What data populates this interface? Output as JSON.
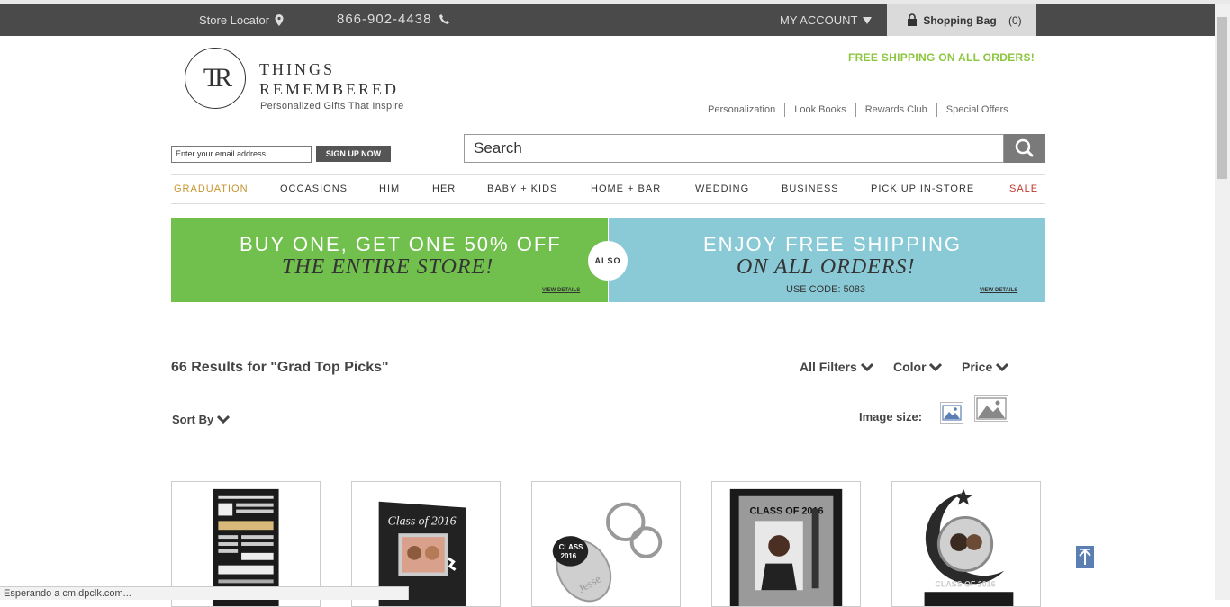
{
  "header": {
    "store_locator": "Store Locator",
    "phone": "866-902-4438",
    "my_account": "MY ACCOUNT",
    "bag_label": "Shopping Bag",
    "bag_count": "(0)"
  },
  "brand": {
    "monogram": "TR",
    "name_line1": "THINGS",
    "name_line2": "REMEMBERED",
    "tagline": "Personalized Gifts That Inspire"
  },
  "free_shipping": "FREE SHIPPING ON ALL ORDERS!",
  "utility_links": [
    "Personalization",
    "Look Books",
    "Rewards Club",
    "Special Offers"
  ],
  "newsletter": {
    "placeholder": "Enter your email address",
    "button": "SIGN UP NOW"
  },
  "search": {
    "placeholder": "Search"
  },
  "nav": [
    {
      "label": "GRADUATION",
      "color": "#c7962f"
    },
    {
      "label": "OCCASIONS"
    },
    {
      "label": "HIM"
    },
    {
      "label": "HER"
    },
    {
      "label": "BABY + KIDS"
    },
    {
      "label": "HOME + BAR"
    },
    {
      "label": "WEDDING"
    },
    {
      "label": "BUSINESS"
    },
    {
      "label": "PICK UP IN-STORE"
    },
    {
      "label": "SALE",
      "color": "#c0392b"
    }
  ],
  "promo": {
    "left_line1": "BUY ONE, GET ONE 50% OFF",
    "left_line2": "THE ENTIRE STORE!",
    "also": "ALSO",
    "right_line1": "ENJOY FREE SHIPPING",
    "right_line2": "ON ALL ORDERS!",
    "code": "USE CODE: 5083",
    "view_details": "VIEW DETAILS",
    "left_color": "#71c04d",
    "right_color": "#8acad6"
  },
  "results": {
    "title": "66 Results for \"Grad Top Picks\"",
    "filters": [
      "All Filters",
      "Color",
      "Price"
    ],
    "sort_by": "Sort By",
    "image_size": "Image size:"
  },
  "products": [
    {
      "name": "Grad inspiration print"
    },
    {
      "name": "Class of 2016 photo album"
    },
    {
      "name": "Class of 2016 keychain"
    },
    {
      "name": "Class of 2016 photo frame"
    },
    {
      "name": "Class of 2016 spinning ornament"
    }
  ],
  "status_bar": "Esperando a cm.dpclk.com..."
}
